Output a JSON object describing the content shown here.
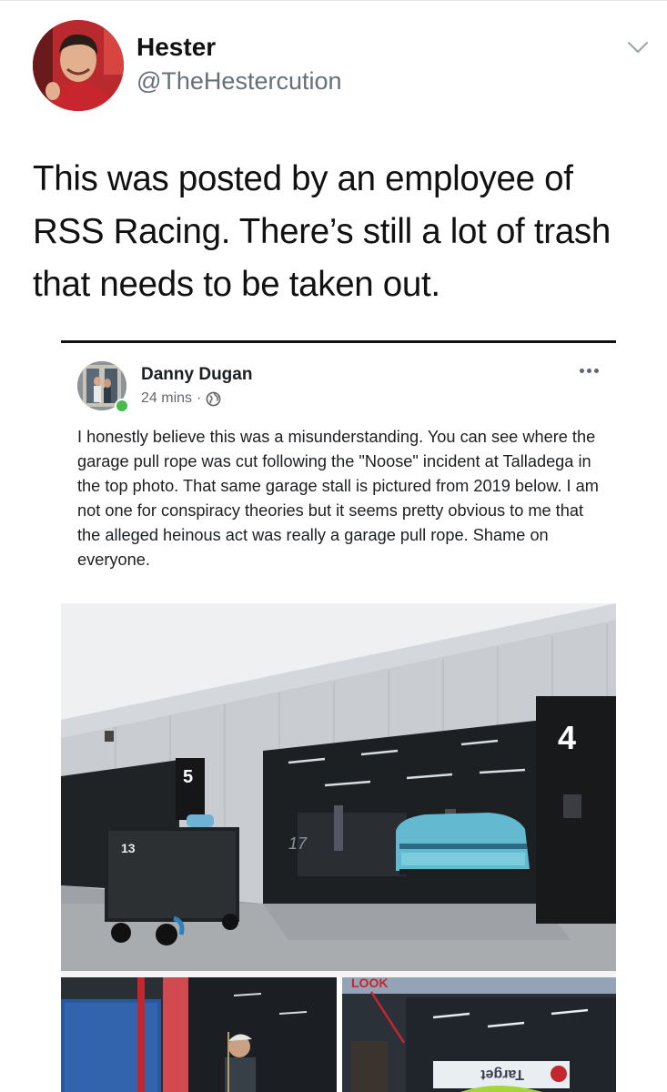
{
  "tweet": {
    "author_name": "Hester",
    "author_handle": "@TheHestercution",
    "text": "This was posted by an employee of RSS Racing. There’s still a lot of trash that needs to be taken out."
  },
  "icons": {
    "more": "chevron-down-icon",
    "privacy": "globe-icon",
    "post_menu": "more-options-icon"
  },
  "embedded_post": {
    "author": "Danny Dugan",
    "time": "24 mins",
    "separator": "·",
    "body": "I honestly believe this was a misunderstanding. You can see where the garage pull rope was cut following the \"Noose\" incident at Talladega in the top photo. That same garage stall is pictured from 2019 below. I am not one for conspiracy theories but it seems pretty obvious to me that the alleged heinous act was really a garage pull rope. Shame on everyone."
  },
  "photos": {
    "main": {
      "stall_left_number": "5",
      "stall_right_number": "4",
      "car_number": "17",
      "cart_label": "13"
    },
    "bottom_right": {
      "annotation": "LOOK",
      "sponsor": "Target"
    }
  },
  "colors": {
    "handle_gray": "#66707a",
    "online_green": "#45bd4a",
    "fb_meta_gray": "#65676b",
    "annotation_red": "#c4262e"
  }
}
